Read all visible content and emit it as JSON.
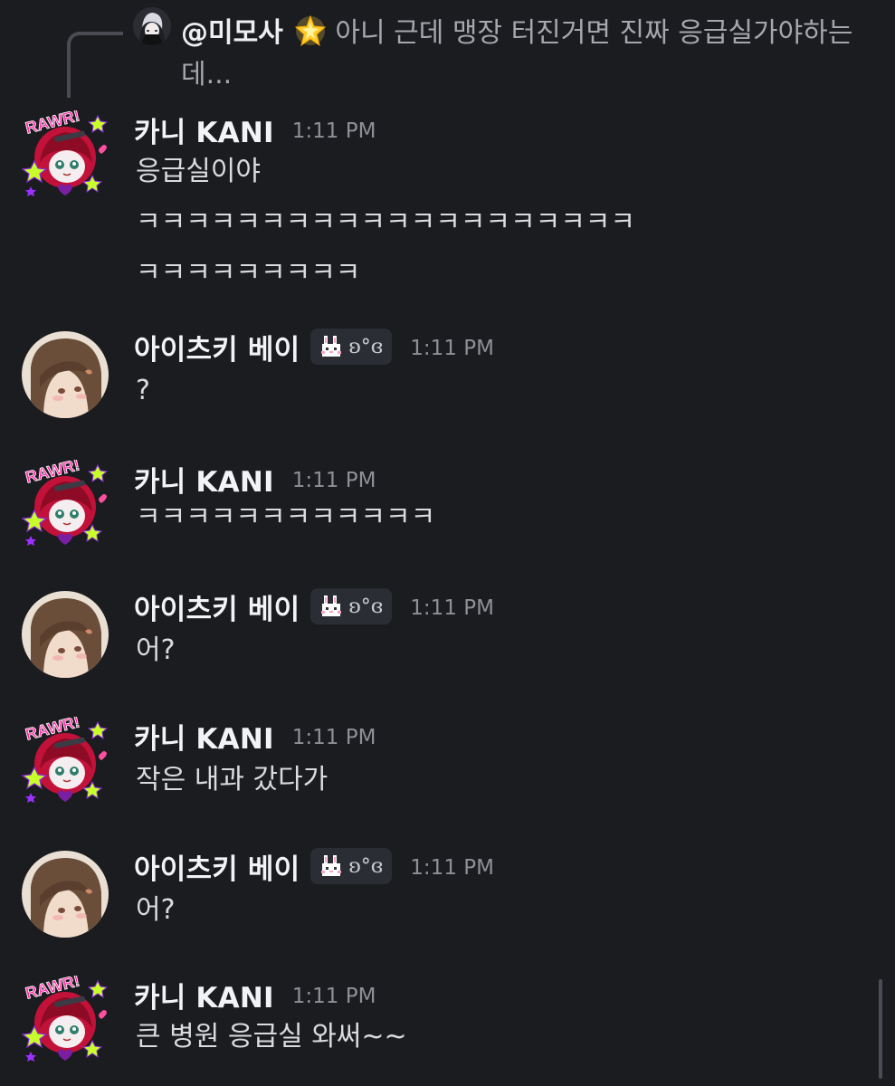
{
  "reply": {
    "author": "@미모사",
    "text": "아니 근데 맹장 터진거면 진짜 응급실가야하는데...",
    "star_icon": "glowing-star-emoji"
  },
  "users": {
    "kani": {
      "name": "카니 KANI",
      "avatar_icon": "rawr-anime-avatar"
    },
    "bei": {
      "name": "아이츠키 베이",
      "avatar_icon": "brown-hair-anime-avatar",
      "tag_text": "ʚ°ɞ",
      "tag_icon": "pixel-bunny-icon"
    }
  },
  "messages": [
    {
      "author": "카니 KANI",
      "time": "1:11 PM",
      "lines": [
        "응급실이야",
        "ㅋㅋㅋㅋㅋㅋㅋㅋㅋㅋㅋㅋㅋㅋㅋㅋㅋㅋㅋㅋ",
        "ㅋㅋㅋㅋㅋㅋㅋㅋㅋ"
      ]
    },
    {
      "author": "아이츠키 베이",
      "tag": "ʚ°ɞ",
      "time": "1:11 PM",
      "lines": [
        "?"
      ]
    },
    {
      "author": "카니 KANI",
      "time": "1:11 PM",
      "lines": [
        "ㅋㅋㅋㅋㅋㅋㅋㅋㅋㅋㅋㅋ"
      ]
    },
    {
      "author": "아이츠키 베이",
      "tag": "ʚ°ɞ",
      "time": "1:11 PM",
      "lines": [
        "어?"
      ]
    },
    {
      "author": "카니 KANI",
      "time": "1:11 PM",
      "lines": [
        "작은 내과 갔다가"
      ]
    },
    {
      "author": "아이츠키 베이",
      "tag": "ʚ°ɞ",
      "time": "1:11 PM",
      "lines": [
        "어?"
      ]
    },
    {
      "author": "카니 KANI",
      "time": "1:11 PM",
      "lines": [
        "큰 병원 응급실 와써~~"
      ]
    }
  ],
  "colors": {
    "background": "#1b1c20",
    "username": "#f2f3f5",
    "timestamp": "#8e9097",
    "message_text": "#dadbdf",
    "reply_text": "#a6a7ae"
  }
}
